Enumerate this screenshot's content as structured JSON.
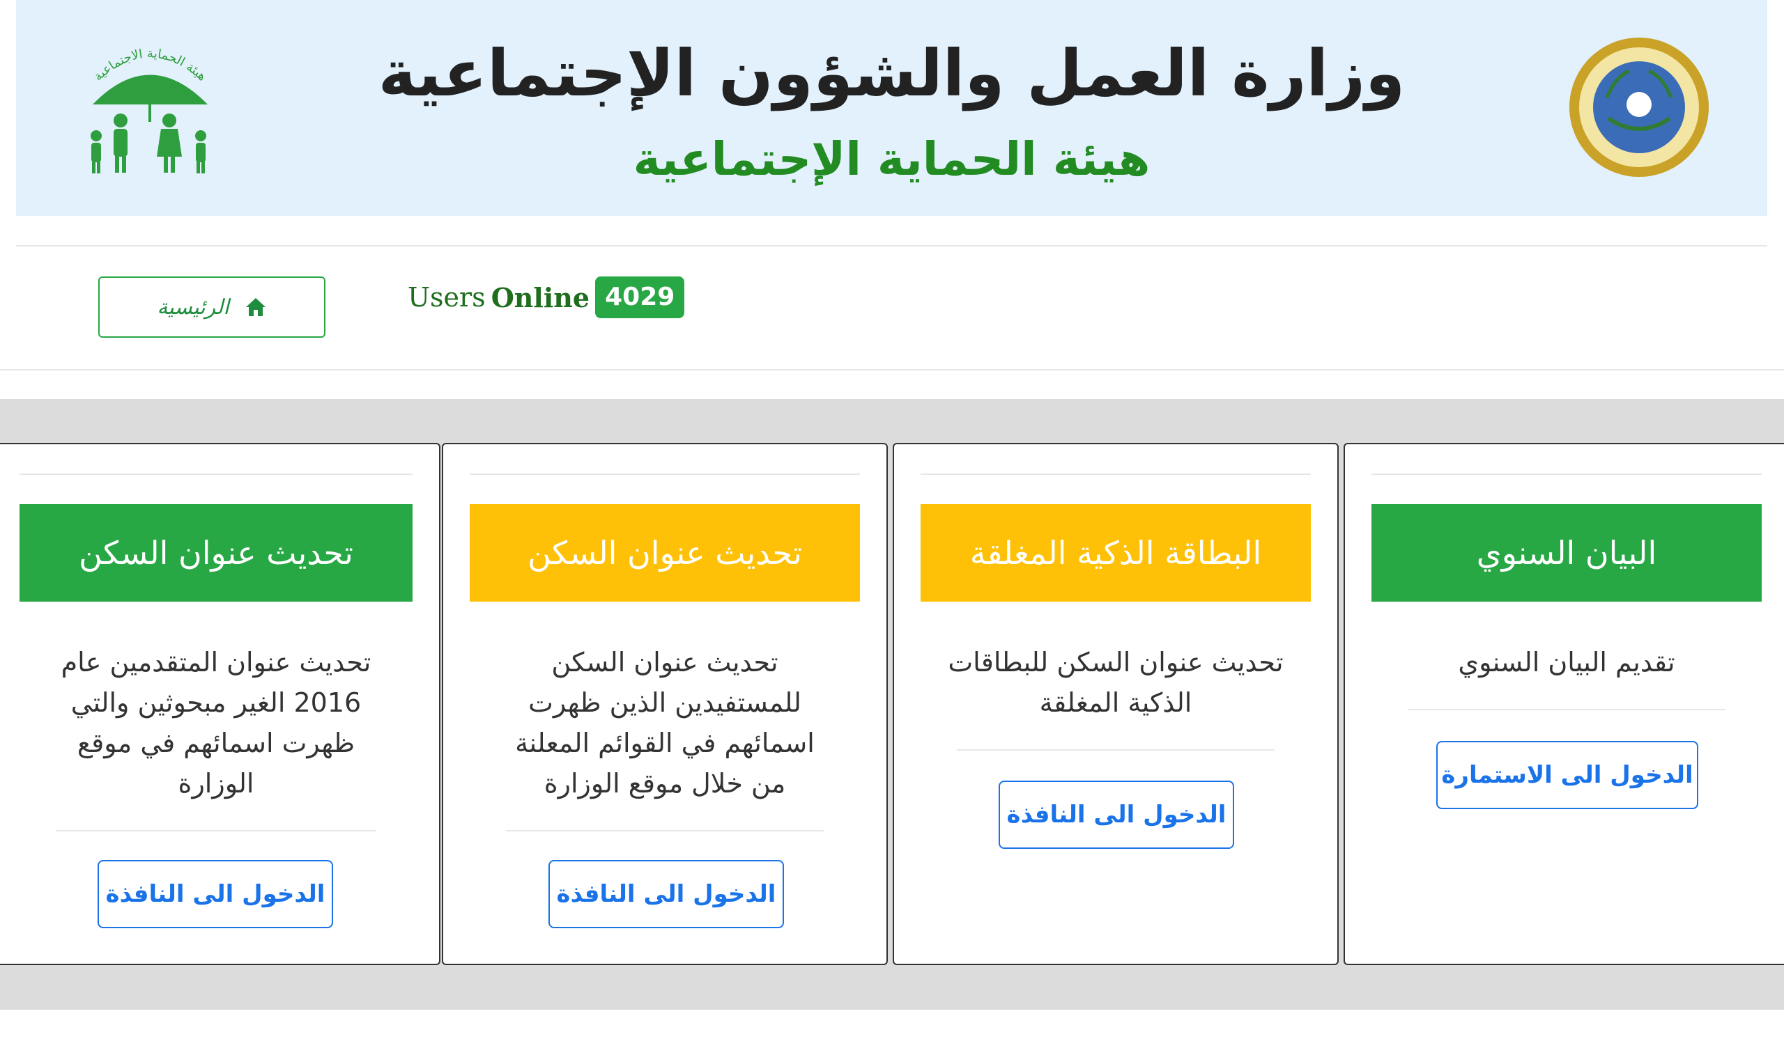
{
  "header": {
    "title": "وزارة العمل والشؤون الإجتماعية",
    "subtitle": "هيئة الحماية الإجتماعية",
    "seal_icon": "ministry-seal-icon",
    "logo_icon": "family-umbrella-logo-icon",
    "logo_text": "هيئة الحماية الاجتماعية"
  },
  "nav": {
    "home_label": "الرئيسية",
    "users_label": "Users",
    "online_label": "Online",
    "online_count": "4029"
  },
  "colors": {
    "header_bg": "#e2f1fc",
    "green": "#28a745",
    "yellow": "#ffc107",
    "link_blue": "#1a73e8",
    "band_gray": "#dcdcdc"
  },
  "cards": [
    {
      "title": "البيان السنوي",
      "color": "green",
      "lines": [
        "تقديم البيان السنوي"
      ],
      "button": "الدخول الى الاستمارة"
    },
    {
      "title": "البطاقة الذكية المغلقة",
      "color": "yellow",
      "lines": [
        "تحديث عنوان السكن للبطاقات",
        "الذكية المغلقة"
      ],
      "button": "الدخول الى النافذة"
    },
    {
      "title": "تحديث عنوان السكن",
      "color": "yellow",
      "lines": [
        "تحديث عنوان السكن",
        "للمستفيدين الذين ظهرت",
        "اسمائهم في القوائم المعلنة",
        "من خلال موقع الوزارة"
      ],
      "button": "الدخول الى النافذة"
    },
    {
      "title": "تحديث عنوان السكن",
      "color": "green",
      "lines": [
        "تحديث عنوان المتقدمين عام",
        "2016 الغير مبحوثين والتي",
        "ظهرت اسمائهم في موقع",
        "الوزارة"
      ],
      "button": "الدخول الى النافذة"
    }
  ]
}
